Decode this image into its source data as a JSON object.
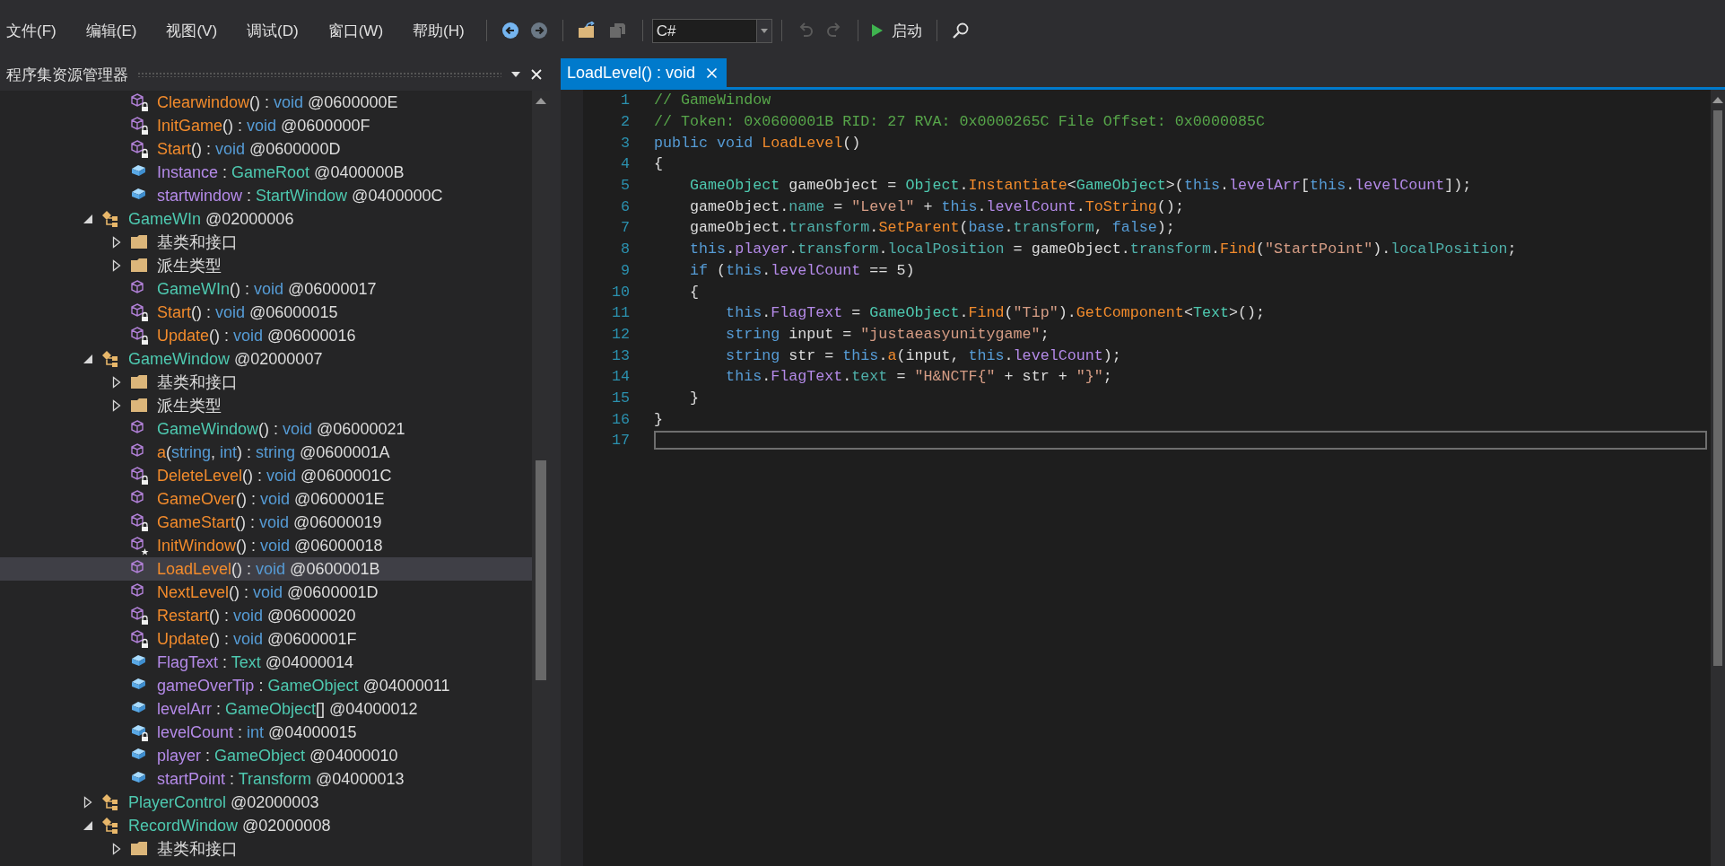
{
  "menu": [
    "文件(F)",
    "编辑(E)",
    "视图(V)",
    "调试(D)",
    "窗口(W)",
    "帮助(H)"
  ],
  "toolbar": [
    [
      {
        "kind": "back",
        "disabled": false
      },
      {
        "kind": "forward",
        "disabled": true
      }
    ],
    [
      {
        "kind": "open",
        "disabled": false
      },
      {
        "kind": "save",
        "disabled": true
      }
    ],
    [
      {
        "kind": "language",
        "value": "C#"
      }
    ],
    [
      {
        "kind": "undo",
        "disabled": true
      },
      {
        "kind": "redo",
        "disabled": true
      }
    ],
    [
      {
        "kind": "start",
        "label": "启动",
        "disabled": false
      }
    ],
    [
      {
        "kind": "search",
        "disabled": false
      }
    ]
  ],
  "explorer": {
    "title": "程序集资源管理器",
    "tree": {
      "orphans": [
        {
          "kind": "lockedmethod",
          "selected": false,
          "parts": [
            {
              "kind": "method",
              "text": "Clearwindow"
            },
            {
              "kind": "plain",
              "text": "() : "
            },
            {
              "kind": "keyword",
              "text": "void"
            },
            {
              "kind": "plain",
              "text": " @0600000E"
            }
          ]
        },
        {
          "kind": "lockedmethod",
          "selected": false,
          "parts": [
            {
              "kind": "method",
              "text": "InitGame"
            },
            {
              "kind": "plain",
              "text": "() : "
            },
            {
              "kind": "keyword",
              "text": "void"
            },
            {
              "kind": "plain",
              "text": " @0600000F"
            }
          ]
        },
        {
          "kind": "lockedmethod",
          "selected": false,
          "parts": [
            {
              "kind": "method",
              "text": "Start"
            },
            {
              "kind": "plain",
              "text": "() : "
            },
            {
              "kind": "keyword",
              "text": "void"
            },
            {
              "kind": "plain",
              "text": " @0600000D"
            }
          ]
        },
        {
          "kind": "field",
          "selected": false,
          "parts": [
            {
              "kind": "field",
              "text": "Instance"
            },
            {
              "kind": "plain",
              "text": " : "
            },
            {
              "kind": "type",
              "text": "GameRoot"
            },
            {
              "kind": "plain",
              "text": " @0400000B"
            }
          ]
        },
        {
          "kind": "field",
          "selected": false,
          "parts": [
            {
              "kind": "field",
              "text": "startwindow"
            },
            {
              "kind": "plain",
              "text": " : "
            },
            {
              "kind": "type",
              "text": "StartWindow"
            },
            {
              "kind": "plain",
              "text": " @0400000C"
            }
          ]
        }
      ],
      "nodes": [
        {
          "kind": "class",
          "expanded": true,
          "selected": false,
          "parts": [
            {
              "kind": "type",
              "text": "GameWIn"
            },
            {
              "kind": "plain",
              "text": " @02000006"
            }
          ],
          "children": [
            {
              "kind": "folder",
              "expanded": false,
              "selected": false,
              "parts": [
                {
                  "kind": "plain",
                  "text": "基类和接口"
                }
              ]
            },
            {
              "kind": "folder",
              "expanded": false,
              "selected": false,
              "parts": [
                {
                  "kind": "plain",
                  "text": "派生类型"
                }
              ]
            },
            {
              "kind": "method",
              "selected": false,
              "parts": [
                {
                  "kind": "type",
                  "text": "GameWIn"
                },
                {
                  "kind": "plain",
                  "text": "() : "
                },
                {
                  "kind": "keyword",
                  "text": "void"
                },
                {
                  "kind": "plain",
                  "text": " @06000017"
                }
              ]
            },
            {
              "kind": "lockedmethod",
              "selected": false,
              "parts": [
                {
                  "kind": "method",
                  "text": "Start"
                },
                {
                  "kind": "plain",
                  "text": "() : "
                },
                {
                  "kind": "keyword",
                  "text": "void"
                },
                {
                  "kind": "plain",
                  "text": " @06000015"
                }
              ]
            },
            {
              "kind": "lockedmethod",
              "selected": false,
              "parts": [
                {
                  "kind": "method",
                  "text": "Update"
                },
                {
                  "kind": "plain",
                  "text": "() : "
                },
                {
                  "kind": "keyword",
                  "text": "void"
                },
                {
                  "kind": "plain",
                  "text": " @06000016"
                }
              ]
            }
          ]
        },
        {
          "kind": "class",
          "expanded": true,
          "selected": false,
          "parts": [
            {
              "kind": "type",
              "text": "GameWindow"
            },
            {
              "kind": "plain",
              "text": " @02000007"
            }
          ],
          "children": [
            {
              "kind": "folder",
              "expanded": false,
              "selected": false,
              "parts": [
                {
                  "kind": "plain",
                  "text": "基类和接口"
                }
              ]
            },
            {
              "kind": "folder",
              "expanded": false,
              "selected": false,
              "parts": [
                {
                  "kind": "plain",
                  "text": "派生类型"
                }
              ]
            },
            {
              "kind": "method",
              "selected": false,
              "parts": [
                {
                  "kind": "type",
                  "text": "GameWindow"
                },
                {
                  "kind": "plain",
                  "text": "() : "
                },
                {
                  "kind": "keyword",
                  "text": "void"
                },
                {
                  "kind": "plain",
                  "text": " @06000021"
                }
              ]
            },
            {
              "kind": "method",
              "selected": false,
              "parts": [
                {
                  "kind": "method",
                  "text": "a"
                },
                {
                  "kind": "plain",
                  "text": "("
                },
                {
                  "kind": "keyword",
                  "text": "string"
                },
                {
                  "kind": "plain",
                  "text": ", "
                },
                {
                  "kind": "keyword",
                  "text": "int"
                },
                {
                  "kind": "plain",
                  "text": ") : "
                },
                {
                  "kind": "keyword",
                  "text": "string"
                },
                {
                  "kind": "plain",
                  "text": " @0600001A"
                }
              ]
            },
            {
              "kind": "lockedmethod",
              "selected": false,
              "parts": [
                {
                  "kind": "method",
                  "text": "DeleteLevel"
                },
                {
                  "kind": "plain",
                  "text": "() : "
                },
                {
                  "kind": "keyword",
                  "text": "void"
                },
                {
                  "kind": "plain",
                  "text": " @0600001C"
                }
              ]
            },
            {
              "kind": "method",
              "selected": false,
              "parts": [
                {
                  "kind": "method",
                  "text": "GameOver"
                },
                {
                  "kind": "plain",
                  "text": "() : "
                },
                {
                  "kind": "keyword",
                  "text": "void"
                },
                {
                  "kind": "plain",
                  "text": " @0600001E"
                }
              ]
            },
            {
              "kind": "lockedmethod",
              "selected": false,
              "parts": [
                {
                  "kind": "method",
                  "text": "GameStart"
                },
                {
                  "kind": "plain",
                  "text": "() : "
                },
                {
                  "kind": "keyword",
                  "text": "void"
                },
                {
                  "kind": "plain",
                  "text": " @06000019"
                }
              ]
            },
            {
              "kind": "starmethod",
              "selected": false,
              "parts": [
                {
                  "kind": "method",
                  "text": "InitWindow"
                },
                {
                  "kind": "plain",
                  "text": "() : "
                },
                {
                  "kind": "keyword",
                  "text": "void"
                },
                {
                  "kind": "plain",
                  "text": " @06000018"
                }
              ]
            },
            {
              "kind": "method",
              "selected": true,
              "parts": [
                {
                  "kind": "method",
                  "text": "LoadLevel"
                },
                {
                  "kind": "plain",
                  "text": "() : "
                },
                {
                  "kind": "keyword",
                  "text": "void"
                },
                {
                  "kind": "plain",
                  "text": " @0600001B"
                }
              ]
            },
            {
              "kind": "method",
              "selected": false,
              "parts": [
                {
                  "kind": "method",
                  "text": "NextLevel"
                },
                {
                  "kind": "plain",
                  "text": "() : "
                },
                {
                  "kind": "keyword",
                  "text": "void"
                },
                {
                  "kind": "plain",
                  "text": " @0600001D"
                }
              ]
            },
            {
              "kind": "lockedmethod",
              "selected": false,
              "parts": [
                {
                  "kind": "method",
                  "text": "Restart"
                },
                {
                  "kind": "plain",
                  "text": "() : "
                },
                {
                  "kind": "keyword",
                  "text": "void"
                },
                {
                  "kind": "plain",
                  "text": " @06000020"
                }
              ]
            },
            {
              "kind": "lockedmethod",
              "selected": false,
              "parts": [
                {
                  "kind": "method",
                  "text": "Update"
                },
                {
                  "kind": "plain",
                  "text": "() : "
                },
                {
                  "kind": "keyword",
                  "text": "void"
                },
                {
                  "kind": "plain",
                  "text": " @0600001F"
                }
              ]
            },
            {
              "kind": "field",
              "selected": false,
              "parts": [
                {
                  "kind": "field",
                  "text": "FlagText"
                },
                {
                  "kind": "plain",
                  "text": " : "
                },
                {
                  "kind": "type",
                  "text": "Text"
                },
                {
                  "kind": "plain",
                  "text": " @04000014"
                }
              ]
            },
            {
              "kind": "field",
              "selected": false,
              "parts": [
                {
                  "kind": "field",
                  "text": "gameOverTip"
                },
                {
                  "kind": "plain",
                  "text": " : "
                },
                {
                  "kind": "type",
                  "text": "GameObject"
                },
                {
                  "kind": "plain",
                  "text": " @04000011"
                }
              ]
            },
            {
              "kind": "field",
              "selected": false,
              "parts": [
                {
                  "kind": "field",
                  "text": "levelArr"
                },
                {
                  "kind": "plain",
                  "text": " : "
                },
                {
                  "kind": "type",
                  "text": "GameObject"
                },
                {
                  "kind": "plain",
                  "text": "[] @04000012"
                }
              ]
            },
            {
              "kind": "lockedfield",
              "selected": false,
              "parts": [
                {
                  "kind": "field",
                  "text": "levelCount"
                },
                {
                  "kind": "plain",
                  "text": " : "
                },
                {
                  "kind": "keyword",
                  "text": "int"
                },
                {
                  "kind": "plain",
                  "text": " @04000015"
                }
              ]
            },
            {
              "kind": "field",
              "selected": false,
              "parts": [
                {
                  "kind": "field",
                  "text": "player"
                },
                {
                  "kind": "plain",
                  "text": " : "
                },
                {
                  "kind": "type",
                  "text": "GameObject"
                },
                {
                  "kind": "plain",
                  "text": " @04000010"
                }
              ]
            },
            {
              "kind": "field",
              "selected": false,
              "parts": [
                {
                  "kind": "field",
                  "text": "startPoint"
                },
                {
                  "kind": "plain",
                  "text": " : "
                },
                {
                  "kind": "type",
                  "text": "Transform"
                },
                {
                  "kind": "plain",
                  "text": " @04000013"
                }
              ]
            }
          ]
        },
        {
          "kind": "class",
          "expanded": false,
          "selected": false,
          "parts": [
            {
              "kind": "type",
              "text": "PlayerControl"
            },
            {
              "kind": "plain",
              "text": " @02000003"
            }
          ]
        },
        {
          "kind": "class",
          "expanded": true,
          "selected": false,
          "parts": [
            {
              "kind": "type",
              "text": "RecordWindow"
            },
            {
              "kind": "plain",
              "text": " @02000008"
            }
          ],
          "children": [
            {
              "kind": "folder",
              "expanded": false,
              "selected": false,
              "parts": [
                {
                  "kind": "plain",
                  "text": "基类和接口"
                }
              ]
            }
          ]
        }
      ]
    }
  },
  "editor": {
    "tabs": [
      {
        "label": "LoadLevel() : void",
        "selected": true
      }
    ],
    "lines": [
      {
        "number": "1",
        "current": false,
        "tokens": [
          {
            "kind": "comment",
            "text": "// GameWindow"
          }
        ]
      },
      {
        "number": "2",
        "current": false,
        "tokens": [
          {
            "kind": "comment",
            "text": "// Token: 0x0600001B RID: 27 RVA: 0x0000265C File Offset: 0x0000085C"
          }
        ]
      },
      {
        "number": "3",
        "current": false,
        "tokens": [
          {
            "kind": "keyword",
            "text": "public void"
          },
          {
            "kind": "method",
            "text": " LoadLevel"
          },
          {
            "kind": "plain",
            "text": "()"
          }
        ]
      },
      {
        "number": "4",
        "current": false,
        "tokens": [
          {
            "kind": "plain",
            "text": "{"
          }
        ]
      },
      {
        "number": "5",
        "current": false,
        "tokens": [
          {
            "kind": "type",
            "text": "    GameObject"
          },
          {
            "kind": "plain",
            "text": " gameObject = "
          },
          {
            "kind": "type",
            "text": "Object"
          },
          {
            "kind": "plain",
            "text": "."
          },
          {
            "kind": "method",
            "text": "Instantiate"
          },
          {
            "kind": "plain",
            "text": "<"
          },
          {
            "kind": "type",
            "text": "GameObject"
          },
          {
            "kind": "plain",
            "text": ">("
          },
          {
            "kind": "keyword",
            "text": "this"
          },
          {
            "kind": "plain",
            "text": "."
          },
          {
            "kind": "field",
            "text": "levelArr"
          },
          {
            "kind": "plain",
            "text": "["
          },
          {
            "kind": "keyword",
            "text": "this"
          },
          {
            "kind": "plain",
            "text": "."
          },
          {
            "kind": "field",
            "text": "levelCount"
          },
          {
            "kind": "plain",
            "text": "]);"
          }
        ]
      },
      {
        "number": "6",
        "current": false,
        "tokens": [
          {
            "kind": "plain",
            "text": "    gameObject."
          },
          {
            "kind": "property",
            "text": "name"
          },
          {
            "kind": "plain",
            "text": " = "
          },
          {
            "kind": "string",
            "text": "\"Level\""
          },
          {
            "kind": "plain",
            "text": " + "
          },
          {
            "kind": "keyword",
            "text": "this"
          },
          {
            "kind": "plain",
            "text": "."
          },
          {
            "kind": "field",
            "text": "levelCount"
          },
          {
            "kind": "plain",
            "text": "."
          },
          {
            "kind": "method",
            "text": "ToString"
          },
          {
            "kind": "plain",
            "text": "();"
          }
        ]
      },
      {
        "number": "7",
        "current": false,
        "tokens": [
          {
            "kind": "plain",
            "text": "    gameObject."
          },
          {
            "kind": "property",
            "text": "transform"
          },
          {
            "kind": "plain",
            "text": "."
          },
          {
            "kind": "method",
            "text": "SetParent"
          },
          {
            "kind": "plain",
            "text": "("
          },
          {
            "kind": "keyword",
            "text": "base"
          },
          {
            "kind": "plain",
            "text": "."
          },
          {
            "kind": "property",
            "text": "transform"
          },
          {
            "kind": "plain",
            "text": ", "
          },
          {
            "kind": "keyword",
            "text": "false"
          },
          {
            "kind": "plain",
            "text": ");"
          }
        ]
      },
      {
        "number": "8",
        "current": false,
        "tokens": [
          {
            "kind": "keyword",
            "text": "    this"
          },
          {
            "kind": "plain",
            "text": "."
          },
          {
            "kind": "field",
            "text": "player"
          },
          {
            "kind": "plain",
            "text": "."
          },
          {
            "kind": "property",
            "text": "transform"
          },
          {
            "kind": "plain",
            "text": "."
          },
          {
            "kind": "property",
            "text": "localPosition"
          },
          {
            "kind": "plain",
            "text": " = gameObject."
          },
          {
            "kind": "property",
            "text": "transform"
          },
          {
            "kind": "plain",
            "text": "."
          },
          {
            "kind": "method",
            "text": "Find"
          },
          {
            "kind": "plain",
            "text": "("
          },
          {
            "kind": "string",
            "text": "\"StartPoint\""
          },
          {
            "kind": "plain",
            "text": ")."
          },
          {
            "kind": "property",
            "text": "localPosition"
          },
          {
            "kind": "plain",
            "text": ";"
          }
        ]
      },
      {
        "number": "9",
        "current": false,
        "tokens": [
          {
            "kind": "keyword",
            "text": "    if"
          },
          {
            "kind": "plain",
            "text": " ("
          },
          {
            "kind": "keyword",
            "text": "this"
          },
          {
            "kind": "plain",
            "text": "."
          },
          {
            "kind": "field",
            "text": "levelCount"
          },
          {
            "kind": "plain",
            "text": " == 5)"
          }
        ]
      },
      {
        "number": "10",
        "current": false,
        "tokens": [
          {
            "kind": "plain",
            "text": "    {"
          }
        ]
      },
      {
        "number": "11",
        "current": false,
        "tokens": [
          {
            "kind": "keyword",
            "text": "        this"
          },
          {
            "kind": "plain",
            "text": "."
          },
          {
            "kind": "field",
            "text": "FlagText"
          },
          {
            "kind": "plain",
            "text": " = "
          },
          {
            "kind": "type",
            "text": "GameObject"
          },
          {
            "kind": "plain",
            "text": "."
          },
          {
            "kind": "method",
            "text": "Find"
          },
          {
            "kind": "plain",
            "text": "("
          },
          {
            "kind": "string",
            "text": "\"Tip\""
          },
          {
            "kind": "plain",
            "text": ")."
          },
          {
            "kind": "method",
            "text": "GetComponent"
          },
          {
            "kind": "plain",
            "text": "<"
          },
          {
            "kind": "type",
            "text": "Text"
          },
          {
            "kind": "plain",
            "text": ">();"
          }
        ]
      },
      {
        "number": "12",
        "current": false,
        "tokens": [
          {
            "kind": "keyword",
            "text": "        string"
          },
          {
            "kind": "plain",
            "text": " input = "
          },
          {
            "kind": "string",
            "text": "\"justaeasyunitygame\""
          },
          {
            "kind": "plain",
            "text": ";"
          }
        ]
      },
      {
        "number": "13",
        "current": false,
        "tokens": [
          {
            "kind": "keyword",
            "text": "        string"
          },
          {
            "kind": "plain",
            "text": " str = "
          },
          {
            "kind": "keyword",
            "text": "this"
          },
          {
            "kind": "plain",
            "text": "."
          },
          {
            "kind": "method",
            "text": "a"
          },
          {
            "kind": "plain",
            "text": "(input, "
          },
          {
            "kind": "keyword",
            "text": "this"
          },
          {
            "kind": "plain",
            "text": "."
          },
          {
            "kind": "field",
            "text": "levelCount"
          },
          {
            "kind": "plain",
            "text": ");"
          }
        ]
      },
      {
        "number": "14",
        "current": false,
        "tokens": [
          {
            "kind": "keyword",
            "text": "        this"
          },
          {
            "kind": "plain",
            "text": "."
          },
          {
            "kind": "field",
            "text": "FlagText"
          },
          {
            "kind": "plain",
            "text": "."
          },
          {
            "kind": "property",
            "text": "text"
          },
          {
            "kind": "plain",
            "text": " = "
          },
          {
            "kind": "string",
            "text": "\"H&NCTF{\""
          },
          {
            "kind": "plain",
            "text": " + str + "
          },
          {
            "kind": "string",
            "text": "\"}\""
          },
          {
            "kind": "plain",
            "text": ";"
          }
        ]
      },
      {
        "number": "15",
        "current": false,
        "tokens": [
          {
            "kind": "plain",
            "text": "    }"
          }
        ]
      },
      {
        "number": "16",
        "current": false,
        "tokens": [
          {
            "kind": "plain",
            "text": "}"
          }
        ]
      },
      {
        "number": "17",
        "current": true
      }
    ]
  }
}
